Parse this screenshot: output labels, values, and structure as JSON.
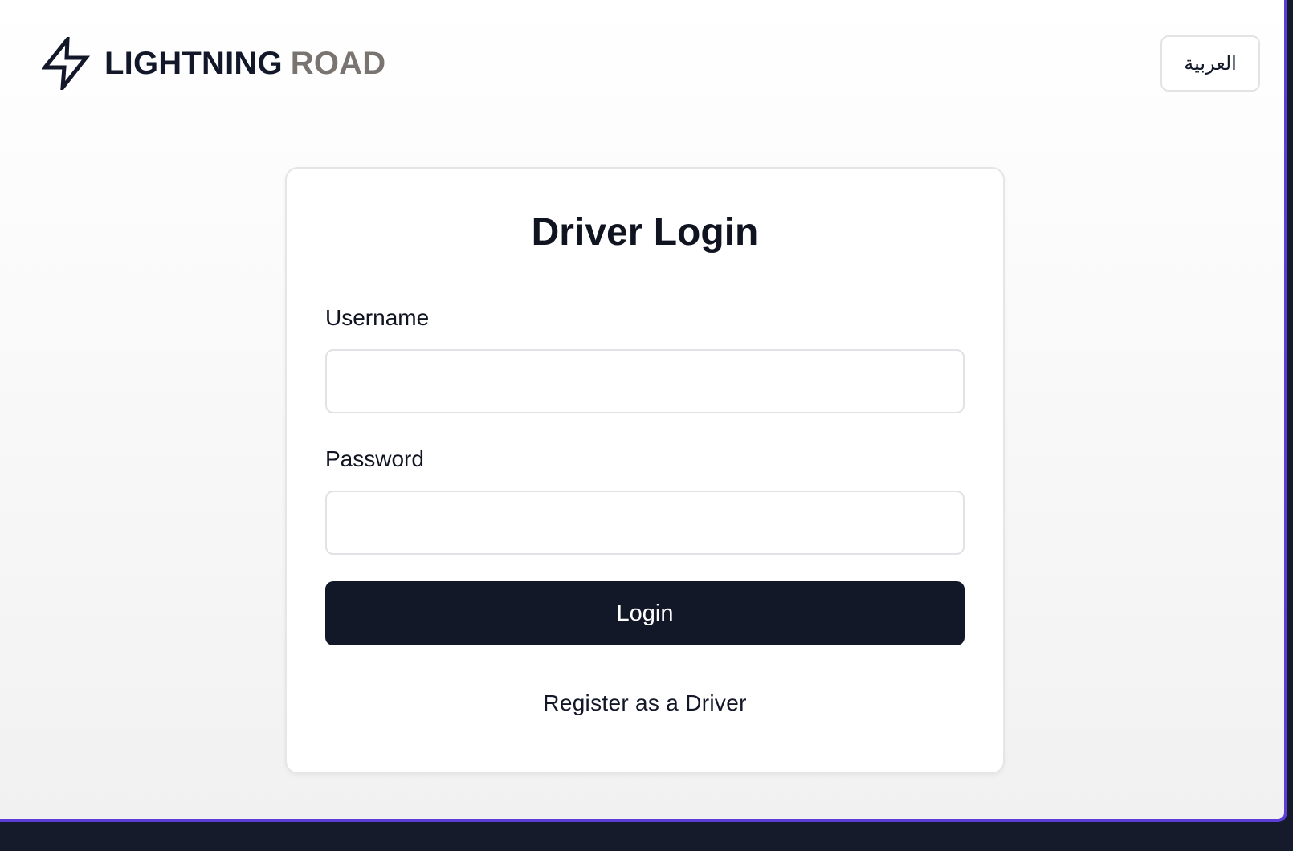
{
  "brand": {
    "word_1": "LIGHTNING",
    "word_2": "ROAD",
    "icon": "lightning-bolt-icon",
    "color_primary": "#121829",
    "color_secondary": "#7a7470"
  },
  "header": {
    "language_toggle_label": "العربية"
  },
  "login_form": {
    "title": "Driver Login",
    "username_label": "Username",
    "username_value": "",
    "password_label": "Password",
    "password_value": "",
    "submit_label": "Login",
    "register_link_label": "Register as a Driver"
  },
  "colors": {
    "button_bg": "#131829",
    "window_accent": "#5b3fd6"
  }
}
